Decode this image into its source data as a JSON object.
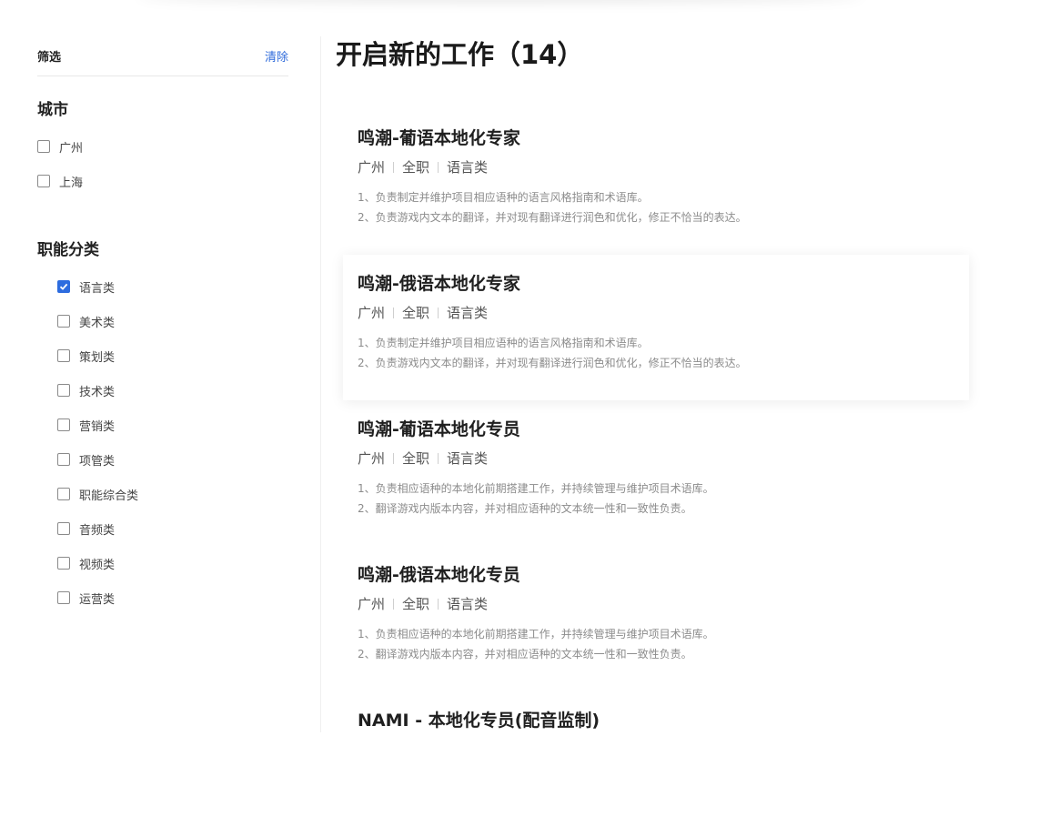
{
  "filter": {
    "title": "筛选",
    "clear_label": "清除"
  },
  "city": {
    "title": "城市",
    "options": [
      {
        "label": "广州",
        "checked": false
      },
      {
        "label": "上海",
        "checked": false
      }
    ]
  },
  "category": {
    "title": "职能分类",
    "options": [
      {
        "label": "语言类",
        "checked": true
      },
      {
        "label": "美术类",
        "checked": false
      },
      {
        "label": "策划类",
        "checked": false
      },
      {
        "label": "技术类",
        "checked": false
      },
      {
        "label": "营销类",
        "checked": false
      },
      {
        "label": "项管类",
        "checked": false
      },
      {
        "label": "职能综合类",
        "checked": false
      },
      {
        "label": "音频类",
        "checked": false
      },
      {
        "label": "视频类",
        "checked": false
      },
      {
        "label": "运营类",
        "checked": false
      }
    ]
  },
  "main": {
    "title": "开启新的工作（14）"
  },
  "jobs": [
    {
      "title": "鸣潮-葡语本地化专家",
      "city": "广州",
      "type": "全职",
      "category": "语言类",
      "desc1": "1、负责制定并维护项目相应语种的语言风格指南和术语库。",
      "desc2": "2、负责游戏内文本的翻译，并对现有翻译进行润色和优化，修正不恰当的表达。"
    },
    {
      "title": "鸣潮-俄语本地化专家",
      "city": "广州",
      "type": "全职",
      "category": "语言类",
      "desc1": "1、负责制定并维护项目相应语种的语言风格指南和术语库。",
      "desc2": "2、负责游戏内文本的翻译，并对现有翻译进行润色和优化，修正不恰当的表达。"
    },
    {
      "title": "鸣潮-葡语本地化专员",
      "city": "广州",
      "type": "全职",
      "category": "语言类",
      "desc1": "1、负责相应语种的本地化前期搭建工作，并持续管理与维护项目术语库。",
      "desc2": "2、翻译游戏内版本内容，并对相应语种的文本统一性和一致性负责。"
    },
    {
      "title": "鸣潮-俄语本地化专员",
      "city": "广州",
      "type": "全职",
      "category": "语言类",
      "desc1": "1、负责相应语种的本地化前期搭建工作，并持续管理与维护项目术语库。",
      "desc2": "2、翻译游戏内版本内容，并对相应语种的文本统一性和一致性负责。"
    },
    {
      "title": "NAMI - 本地化专员(配音监制)",
      "city": "",
      "type": "",
      "category": "",
      "desc1": "",
      "desc2": ""
    }
  ],
  "colors": {
    "accent": "#2d6cdf",
    "link": "#2f6bdb",
    "desc_text": "#8c8c8c"
  }
}
